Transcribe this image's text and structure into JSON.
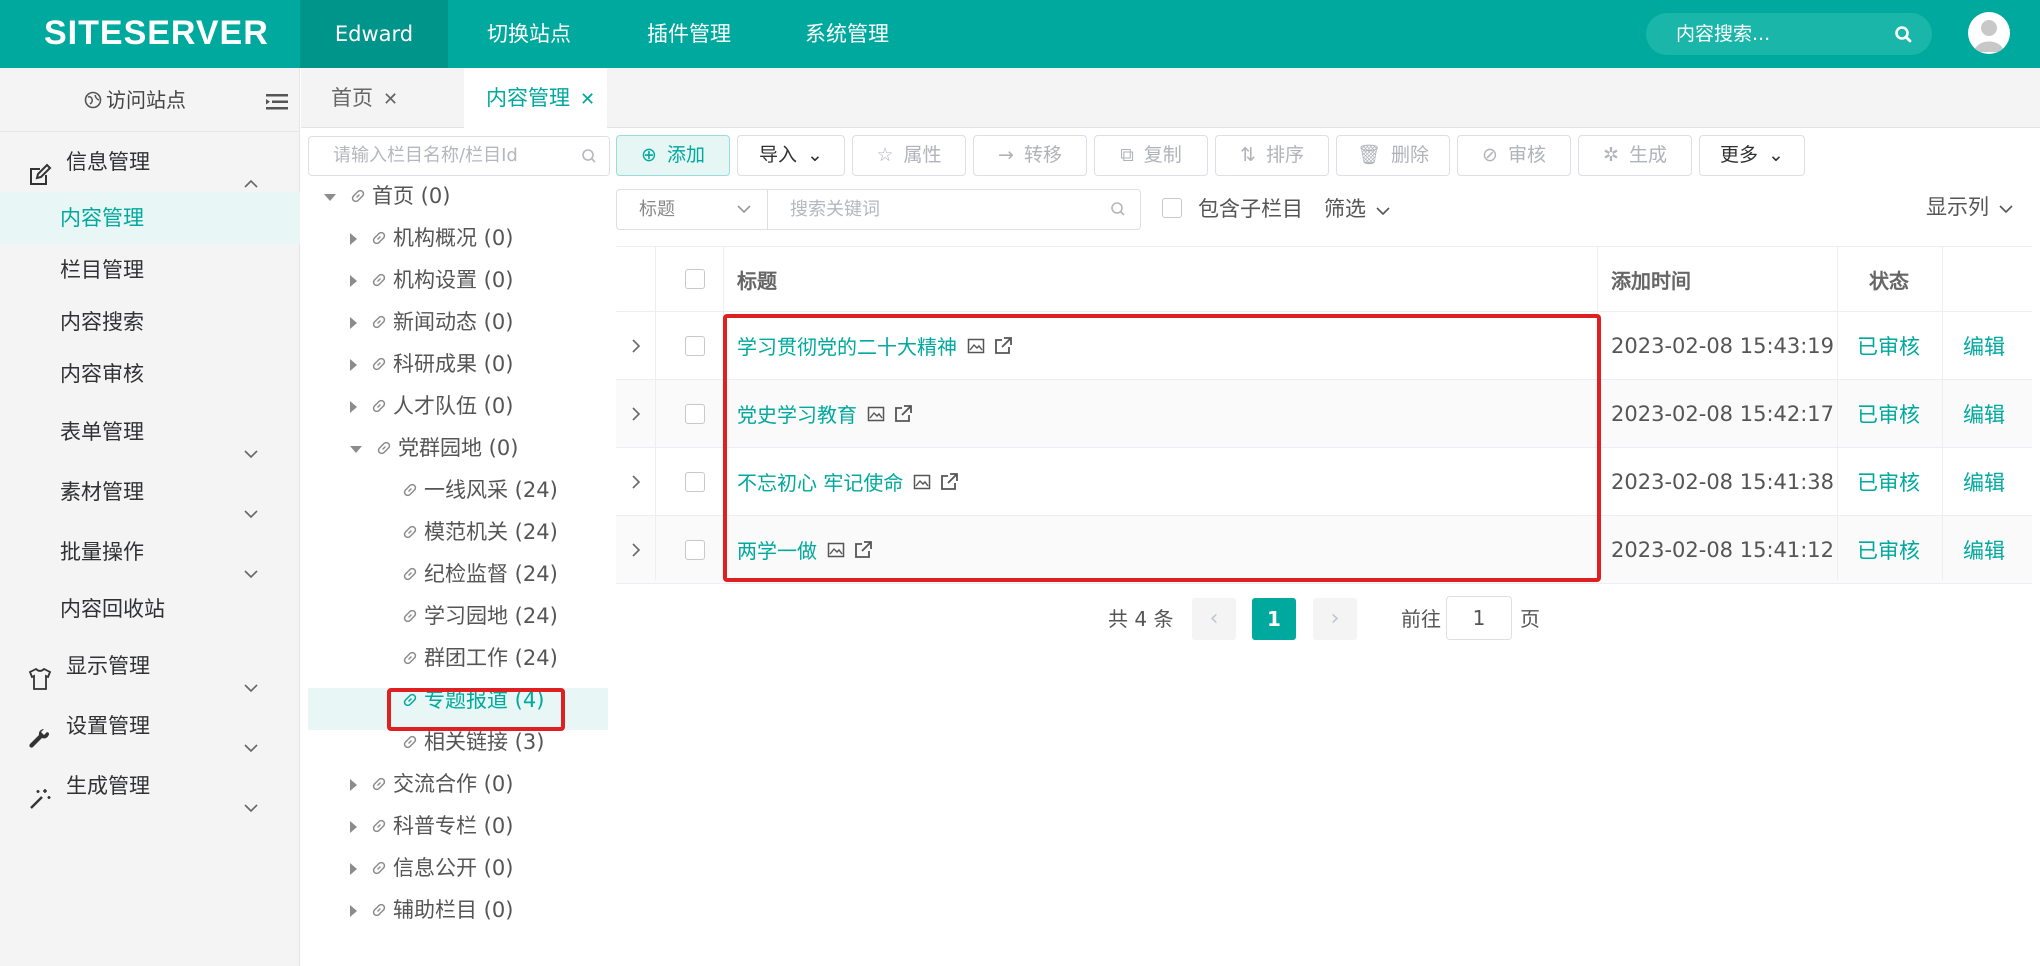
{
  "header": {
    "logo": "SITESERVER",
    "nav": [
      "Edward",
      "切换站点",
      "插件管理",
      "系统管理"
    ],
    "search_placeholder": "内容搜索..."
  },
  "sidebar": {
    "visit_site": "访问站点",
    "items": [
      {
        "label": "信息管理",
        "icon": "edit-icon",
        "expanded": true
      },
      {
        "label": "内容管理",
        "active": true
      },
      {
        "label": "栏目管理"
      },
      {
        "label": "内容搜索"
      },
      {
        "label": "内容审核"
      },
      {
        "label": "表单管理"
      },
      {
        "label": "素材管理"
      },
      {
        "label": "批量操作"
      },
      {
        "label": "内容回收站"
      },
      {
        "label": "显示管理",
        "icon": "shirt-icon"
      },
      {
        "label": "设置管理",
        "icon": "wrench-icon"
      },
      {
        "label": "生成管理",
        "icon": "magic-wand-icon"
      }
    ]
  },
  "tabs": [
    {
      "label": "首页"
    },
    {
      "label": "内容管理",
      "active": true
    }
  ],
  "tree": {
    "search_placeholder": "请输入栏目名称/栏目Id",
    "nodes": [
      "首页 (0)",
      "机构概况 (0)",
      "机构设置 (0)",
      "新闻动态 (0)",
      "科研成果 (0)",
      "人才队伍 (0)",
      "党群园地 (0)",
      "一线风采 (24)",
      "模范机关 (24)",
      "纪检监督 (24)",
      "学习园地 (24)",
      "群团工作 (24)",
      "专题报道 (4)",
      "相关链接 (3)",
      "交流合作 (0)",
      "科普专栏 (0)",
      "信息公开 (0)",
      "辅助栏目 (0)"
    ]
  },
  "toolbar": {
    "buttons": [
      "添加",
      "导入",
      "属性",
      "转移",
      "复制",
      "排序",
      "删除",
      "审核",
      "生成",
      "更多"
    ]
  },
  "filter": {
    "field": "标题",
    "keyword_placeholder": "搜索关键词",
    "include_children": "包含子栏目",
    "filter_label": "筛选",
    "columns_label": "显示列"
  },
  "table": {
    "headers": [
      "标题",
      "添加时间",
      "状态"
    ],
    "rows": [
      {
        "title": "学习贯彻党的二十大精神",
        "time": "2023-02-08 15:43:19",
        "status": "已审核",
        "action": "编辑"
      },
      {
        "title": "党史学习教育",
        "time": "2023-02-08 15:42:17",
        "status": "已审核",
        "action": "编辑"
      },
      {
        "title": "不忘初心 牢记使命",
        "time": "2023-02-08 15:41:38",
        "status": "已审核",
        "action": "编辑"
      },
      {
        "title": "两学一做",
        "time": "2023-02-08 15:41:12",
        "status": "已审核",
        "action": "编辑"
      }
    ]
  },
  "pager": {
    "total": "共 4 条",
    "current": "1",
    "goto": "前往",
    "goto_value": "1",
    "unit": "页"
  },
  "colors": {
    "brand": "#00a99d",
    "highlight": "#e02020"
  }
}
